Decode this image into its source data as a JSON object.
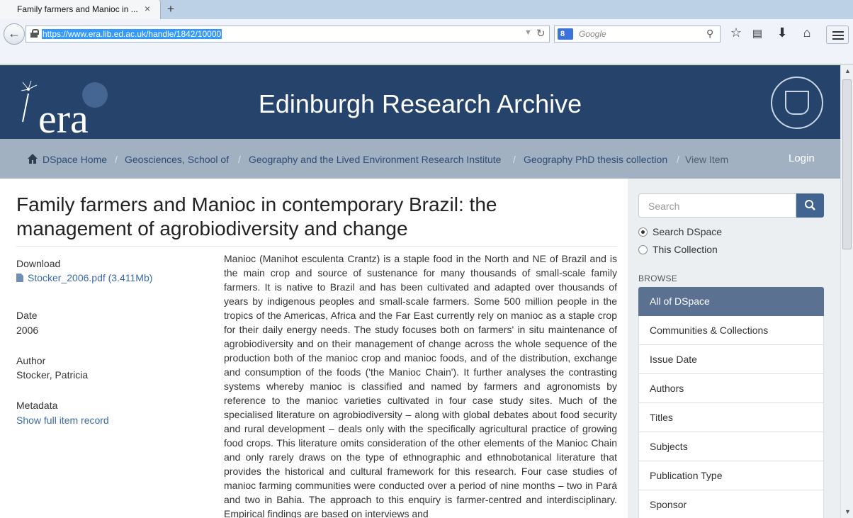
{
  "browser": {
    "tab_title": "Family farmers and Manioc in ...",
    "tab_close": "×",
    "new_tab": "+",
    "url": "https://www.era.lib.ed.ac.uk/handle/1842/10000",
    "search_engine_placeholder": "Google",
    "search_engine_badge": "8",
    "icons": [
      "back-arrow-icon",
      "lock-icon",
      "reload-icon",
      "magnifier-icon",
      "bookmark-star-icon",
      "reading-list-icon",
      "download-icon",
      "home-icon",
      "hamburger-menu-icon"
    ]
  },
  "header": {
    "logo_text": "era",
    "site_title": "Edinburgh Research Archive",
    "seal_label": "THE UNIVERSITY OF EDINBURGH"
  },
  "breadcrumb": {
    "items": [
      "DSpace Home",
      "Geosciences, School of",
      "Geography and the Lived Environment Research Institute",
      "Geography PhD thesis collection",
      "View Item"
    ],
    "separator": "/",
    "login": "Login"
  },
  "item": {
    "title": "Family farmers and Manioc in contemporary Brazil: the management of agrobiodiversity and change",
    "download_label": "Download",
    "file_link": "Stocker_2006.pdf (3.411Mb)",
    "date_label": "Date",
    "date_value": "2006",
    "author_label": "Author",
    "author_value": "Stocker, Patricia",
    "metadata_label": "Metadata",
    "metadata_link": "Show full item record",
    "abstract": "Manioc (Manihot esculenta Crantz) is a staple food in the North and NE of Brazil and is the main crop and source of sustenance for many thousands of small-scale family farmers. It is native to Brazil and has been cultivated and adapted over thousands of years by indigenous peoples and small-scale farmers. Some 500 million people in the tropics of the Americas, Africa and the Far East currently rely on manioc as a staple crop  for their daily energy needs.  The study focuses both on farmers' in situ maintenance of agrobiodiversity and on their management of change across the whole sequence of the production both of the manioc  crop and manioc foods, and of the distribution, exchange and consumption of the foods  ('the Manioc Chain'). It further analyses the contrasting systems whereby manioc is classified and named by farmers and agronomists by reference to the manioc varieties cultivated in four case study sites. Much of the specialised literature on agrobiodiversity – along with global debates about food security and rural development – deals only with  the specifically agricultural practice of growing food crops. This literature omits consideration of the other elements of the Manioc Chain and only rarely draws on the  type of ethnographic and ethnobotanical literature that provides the historical and  cultural framework for this research.  Four case studies of manioc farming communities were conducted over a period of nine months – two in Pará and two in Bahia. The approach to this enquiry is farmer-centred  and interdisciplinary. Empirical findings are based on interviews and"
  },
  "sidebar": {
    "search_placeholder": "Search",
    "scope_options": [
      "Search DSpace",
      "This Collection"
    ],
    "scope_selected": "Search DSpace",
    "browse_heading": "BROWSE",
    "browse_items": [
      "All of DSpace",
      "Communities & Collections",
      "Issue Date",
      "Authors",
      "Titles",
      "Subjects",
      "Publication Type",
      "Sponsor"
    ],
    "browse_active": "All of DSpace"
  },
  "colors": {
    "header_bg": "#25436b",
    "trail_bg": "#a2b1c1",
    "link": "#3a6aa8",
    "sidebar_active": "#5a7192",
    "search_button": "#416590"
  }
}
